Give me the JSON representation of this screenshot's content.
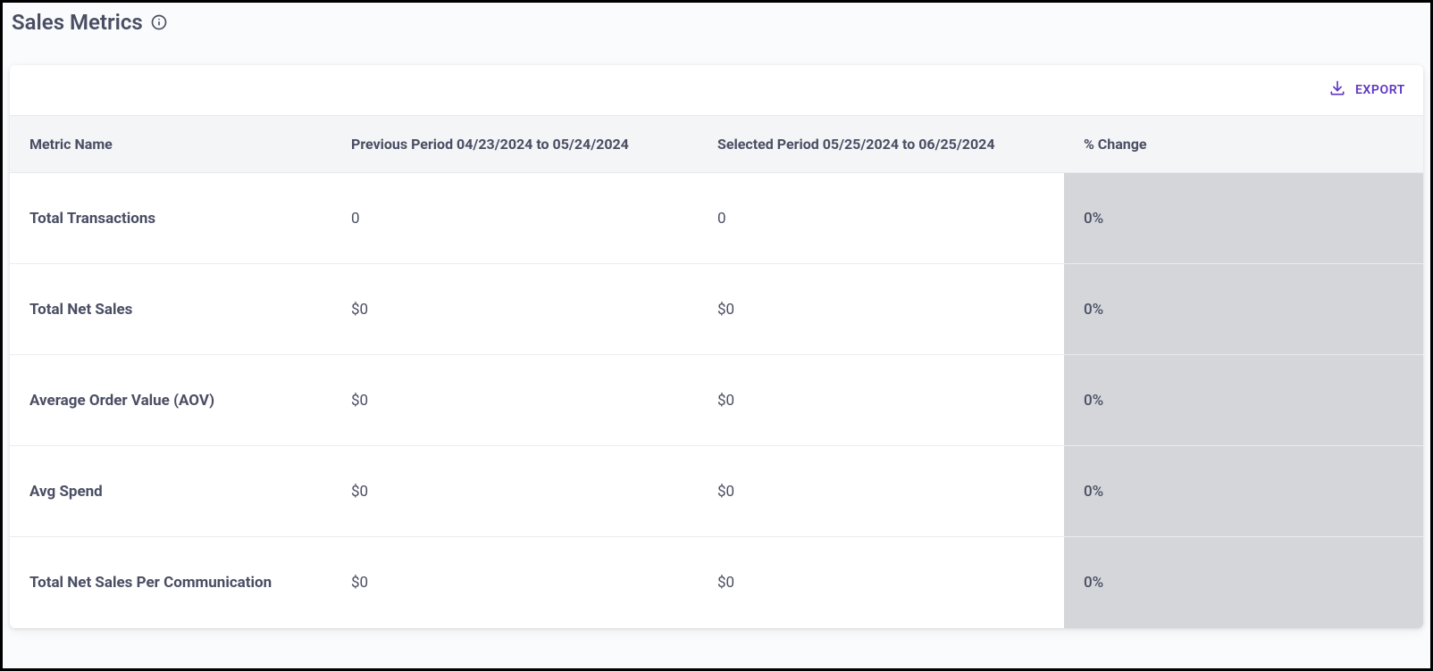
{
  "page": {
    "title": "Sales Metrics"
  },
  "toolbar": {
    "export_label": "EXPORT"
  },
  "table": {
    "columns": {
      "metric_name": "Metric Name",
      "previous_period": "Previous Period 04/23/2024 to 05/24/2024",
      "selected_period": "Selected Period 05/25/2024 to 06/25/2024",
      "pct_change": "% Change"
    },
    "rows": [
      {
        "name": "Total Transactions",
        "previous": "0",
        "selected": "0",
        "change": "0%"
      },
      {
        "name": "Total Net Sales",
        "previous": "$0",
        "selected": "$0",
        "change": "0%"
      },
      {
        "name": "Average Order Value (AOV)",
        "previous": "$0",
        "selected": "$0",
        "change": "0%"
      },
      {
        "name": "Avg Spend",
        "previous": "$0",
        "selected": "$0",
        "change": "0%"
      },
      {
        "name": "Total Net Sales Per Communication",
        "previous": "$0",
        "selected": "$0",
        "change": "0%"
      }
    ]
  }
}
